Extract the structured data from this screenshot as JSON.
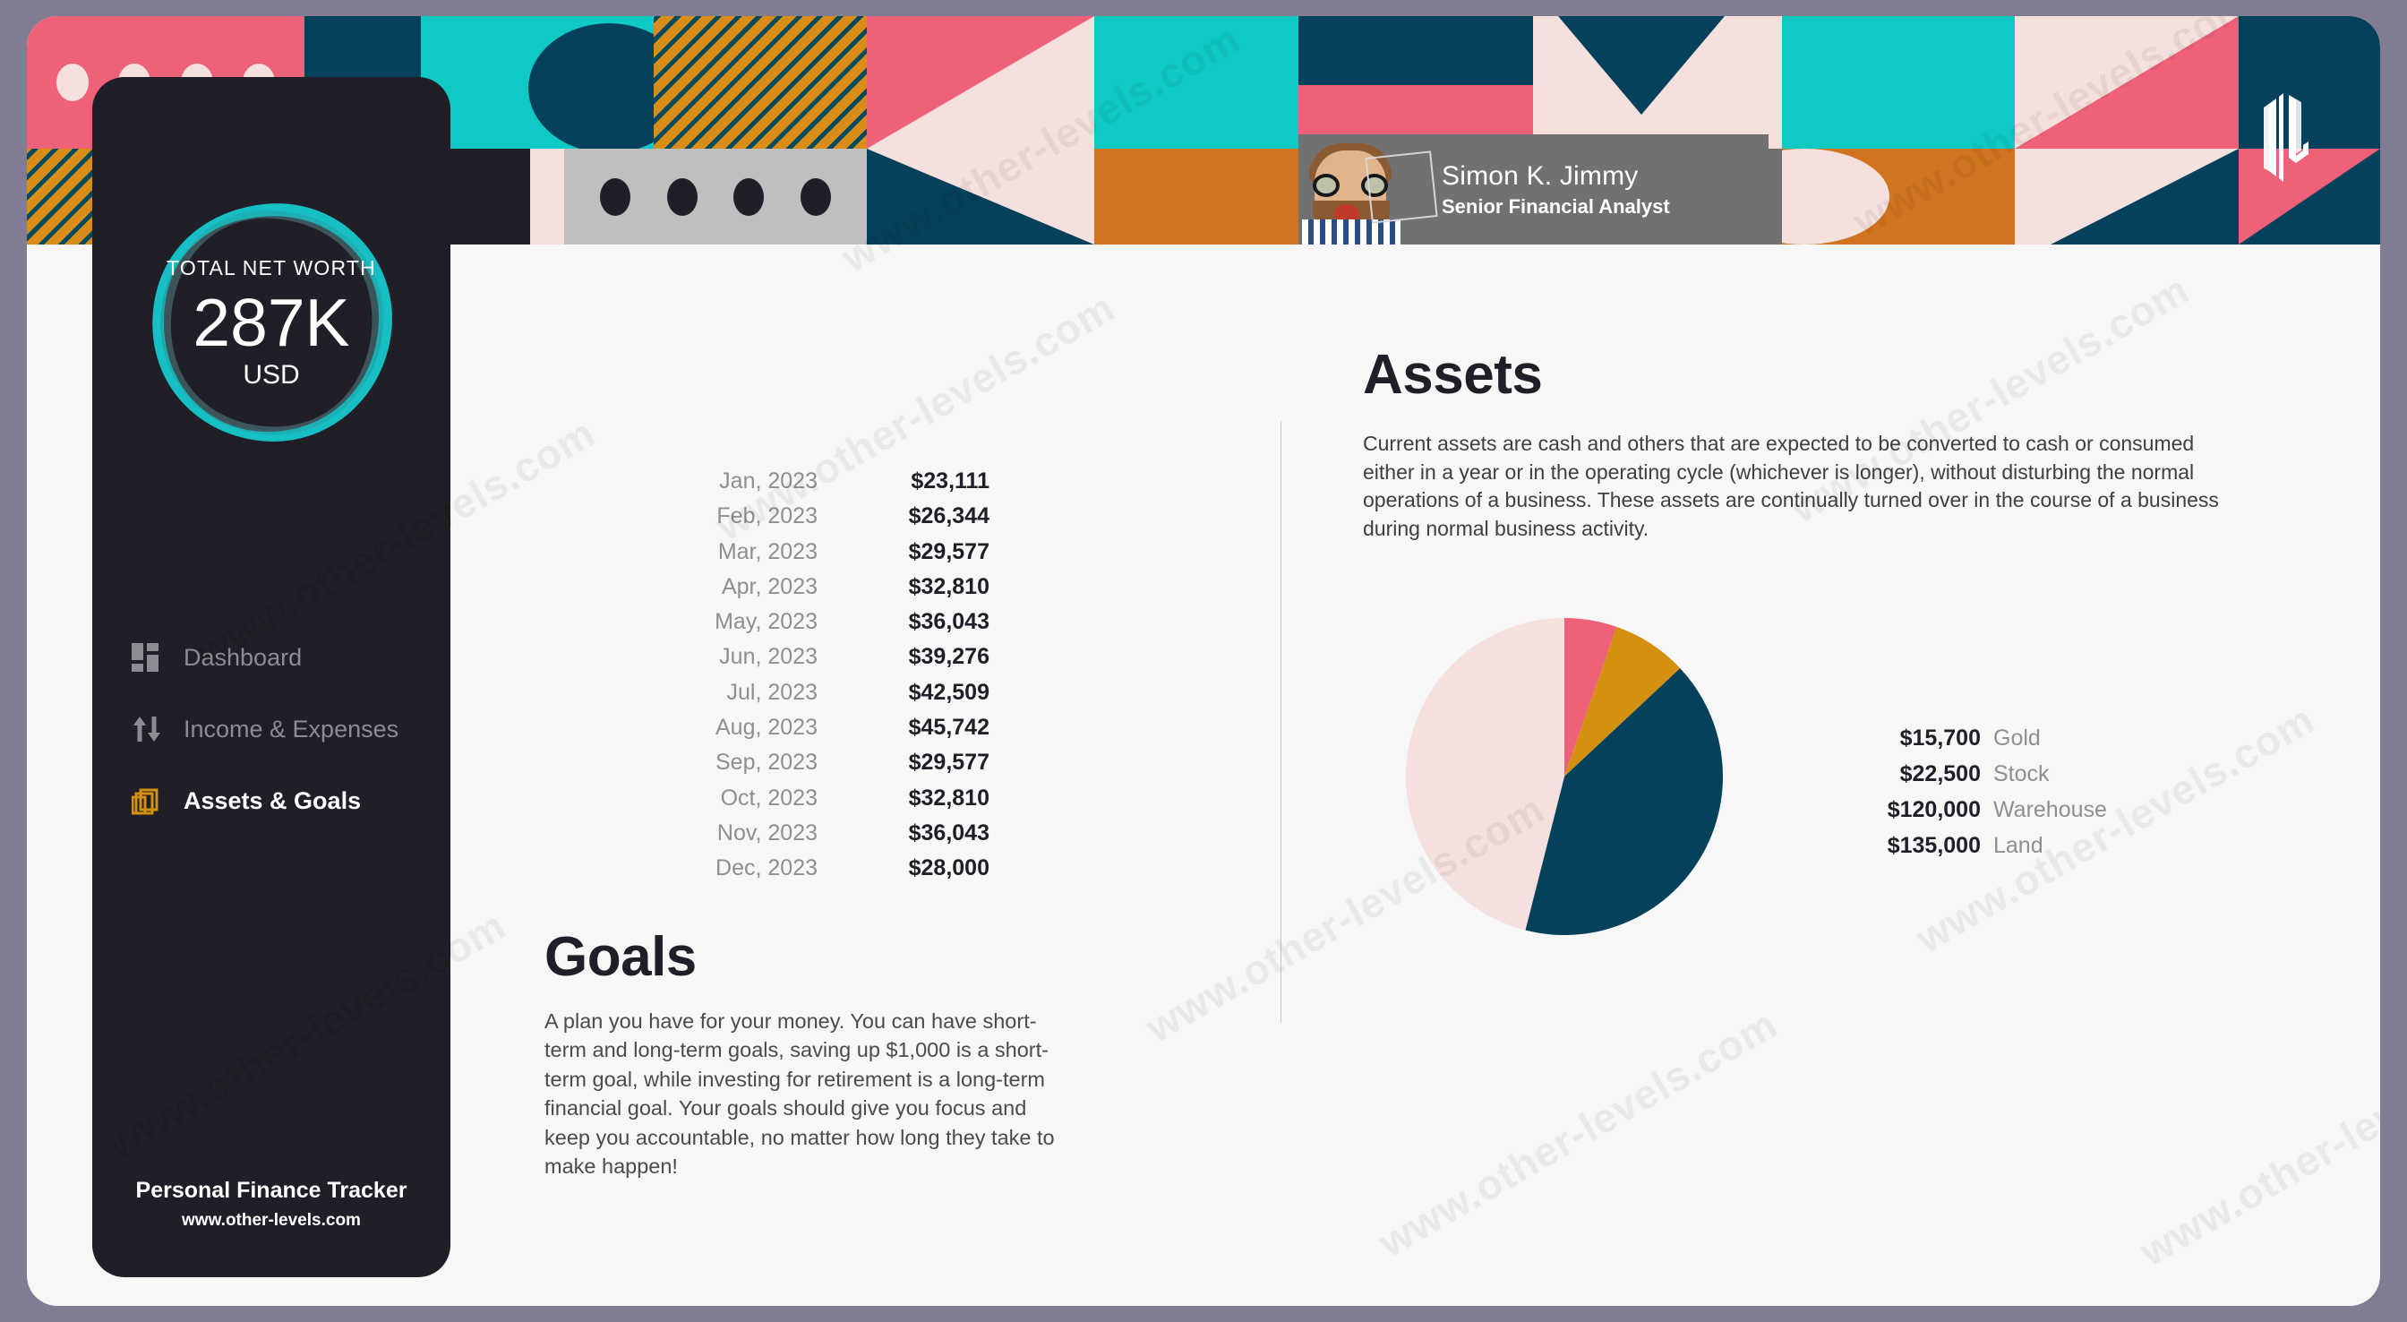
{
  "app": {
    "brand_name": "Personal Finance Tracker",
    "brand_url": "www.other-levels.com",
    "logo_name": "ol-logo"
  },
  "profile": {
    "name": "Simon K. Jimmy",
    "role": "Senior Financial Analyst"
  },
  "net_worth": {
    "label": "TOTAL NET WORTH",
    "value": "287K",
    "currency": "USD",
    "ring_color": "#16bfc4"
  },
  "sidebar": {
    "items": [
      {
        "label": "Dashboard",
        "icon": "dashboard-grid-icon",
        "active": false
      },
      {
        "label": "Income & Expenses",
        "icon": "arrows-up-down-icon",
        "active": false
      },
      {
        "label": "Assets & Goals",
        "icon": "layers-stack-icon",
        "active": true
      }
    ]
  },
  "months": {
    "rows": [
      {
        "label": "Jan, 2023",
        "value": "$23,111"
      },
      {
        "label": "Feb, 2023",
        "value": "$26,344"
      },
      {
        "label": "Mar, 2023",
        "value": "$29,577"
      },
      {
        "label": "Apr, 2023",
        "value": "$32,810"
      },
      {
        "label": "May, 2023",
        "value": "$36,043"
      },
      {
        "label": "Jun, 2023",
        "value": "$39,276"
      },
      {
        "label": "Jul, 2023",
        "value": "$42,509"
      },
      {
        "label": "Aug, 2023",
        "value": "$45,742"
      },
      {
        "label": "Sep, 2023",
        "value": "$29,577"
      },
      {
        "label": "Oct, 2023",
        "value": "$32,810"
      },
      {
        "label": "Nov, 2023",
        "value": "$36,043"
      },
      {
        "label": "Dec, 2023",
        "value": "$28,000"
      }
    ]
  },
  "goals": {
    "title": "Goals",
    "body": "A plan you have for your money. You can have short-term and long-term goals, saving up $1,000 is a short-term goal, while investing for retirement is a long-term financial goal. Your goals should give you focus and keep you accountable, no matter how long they take to make happen!"
  },
  "assets": {
    "title": "Assets",
    "body": "Current assets are cash and others that are expected to be converted to cash or consumed either in a year or in the operating cycle (whichever is longer), without disturbing the normal operations of a business. These assets are continually turned over in the course of a business during normal business activity."
  },
  "chart_data": {
    "type": "pie",
    "title": "Assets",
    "categories": [
      "Gold",
      "Stock",
      "Warehouse",
      "Land"
    ],
    "values": [
      15700,
      22500,
      120000,
      135000
    ],
    "value_labels": [
      "$15,700",
      "$22,500",
      "$120,000",
      "$135,000"
    ],
    "colors": [
      "#ef6179",
      "#d4900f",
      "#05415a",
      "#f4e0dd"
    ],
    "percentages": [
      5.4,
      7.7,
      41.2,
      45.7
    ],
    "total": 293200,
    "legend_position": "right",
    "start_angle": 0
  },
  "watermarks": {
    "text": "www.other-levels.com"
  }
}
